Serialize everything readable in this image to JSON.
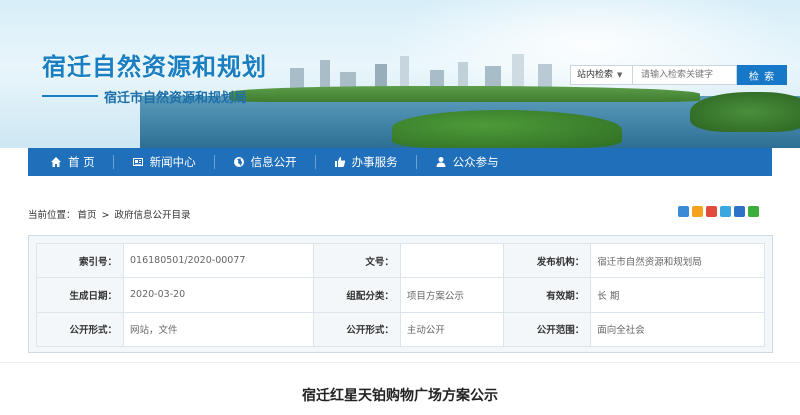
{
  "site": {
    "title": "宿迁自然资源和规划",
    "subtitle": "宿迁市自然资源和规划局"
  },
  "search": {
    "scope_label": "站内检索",
    "placeholder": "请输入检索关键字",
    "button_label": "检 索"
  },
  "nav": {
    "items": [
      {
        "label": "首  页",
        "icon": "home-icon"
      },
      {
        "label": "新闻中心",
        "icon": "news-icon"
      },
      {
        "label": "信息公开",
        "icon": "globe-icon"
      },
      {
        "label": "办事服务",
        "icon": "thumbs-up-icon"
      },
      {
        "label": "公众参与",
        "icon": "person-icon"
      }
    ]
  },
  "breadcrumb": {
    "prefix": "当前位置：",
    "home": "首页",
    "sep": " > ",
    "current": "政府信息公开目录"
  },
  "share_colors": [
    "#3a8ad6",
    "#f2a21c",
    "#e04b3c",
    "#39a8e0",
    "#2e71c7",
    "#3cae3a"
  ],
  "info": {
    "rows": [
      [
        {
          "key": "索引号：",
          "value": "016180501/2020-00077"
        },
        {
          "key": "文号：",
          "value": ""
        },
        {
          "key": "发布机构：",
          "value": "宿迁市自然资源和规划局"
        }
      ],
      [
        {
          "key": "生成日期：",
          "value": "2020-03-20"
        },
        {
          "key": "组配分类：",
          "value": "项目方案公示"
        },
        {
          "key": "有效期：",
          "value": "长 期"
        }
      ],
      [
        {
          "key": "公开形式：",
          "value": "网站，文件"
        },
        {
          "key": "公开形式：",
          "value": "主动公开"
        },
        {
          "key": "公开范围：",
          "value": "面向全社会"
        }
      ]
    ]
  },
  "document": {
    "title": "宿迁红星天铂购物广场方案公示"
  }
}
